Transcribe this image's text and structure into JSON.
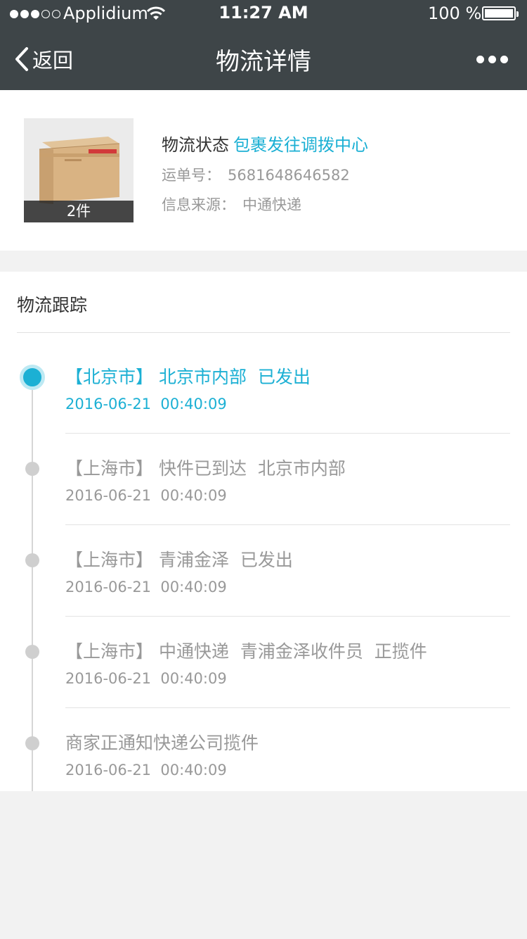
{
  "status_bar": {
    "carrier": "Applidium",
    "time": "11:27 AM",
    "battery": "100 %"
  },
  "nav": {
    "back_label": "返回",
    "title": "物流详情",
    "more_icon": "more-icon"
  },
  "package": {
    "quantity": "2件",
    "status_label": "物流状态",
    "status_value": "包裹发往调拨中心",
    "tracking_label": "运单号：",
    "tracking_number": "5681648646582",
    "source_label": "信息来源：",
    "source_value": "中通快递"
  },
  "tracking": {
    "title": "物流跟踪",
    "events": [
      {
        "desc": "【北京市】 北京市内部  已发出",
        "time": "2016-06-21  00:40:09"
      },
      {
        "desc": "【上海市】 快件已到达  北京市内部",
        "time": "2016-06-21  00:40:09"
      },
      {
        "desc": "【上海市】 青浦金泽  已发出",
        "time": "2016-06-21  00:40:09"
      },
      {
        "desc": "【上海市】 中通快递  青浦金泽收件员  正揽件",
        "time": "2016-06-21  00:40:09"
      },
      {
        "desc": "商家正通知快递公司揽件",
        "time": "2016-06-21  00:40:09"
      }
    ]
  },
  "colors": {
    "nav_bg": "#3e4548",
    "accent": "#1cb0d4",
    "muted_text": "#999999"
  }
}
